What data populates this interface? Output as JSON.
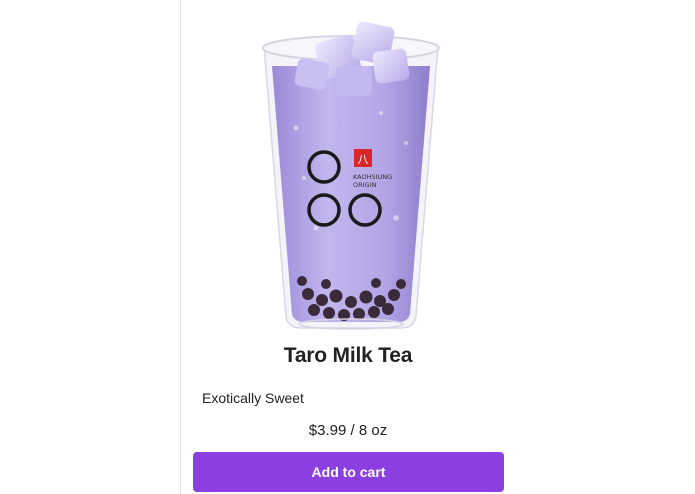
{
  "product": {
    "title": "Taro Milk Tea",
    "description": "Exotically Sweet",
    "price": "$3.99 / 8 oz",
    "add_to_cart_label": "Add to cart",
    "image_logo_text": [
      "KAOHSIUNG",
      "ORIGIN"
    ],
    "image_logo_badge": "八"
  },
  "colors": {
    "accent": "#8b3fe0",
    "drink": "#b3a4e6",
    "pearls": "#3a2b3a"
  },
  "icons": {
    "logo": "brand-logo-icon"
  }
}
